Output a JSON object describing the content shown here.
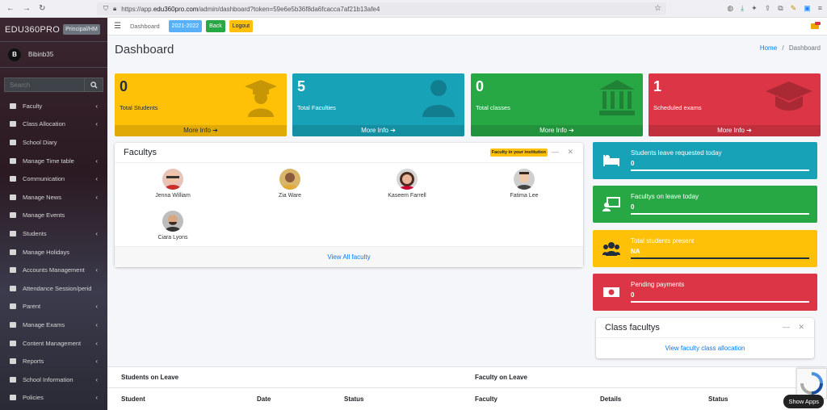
{
  "browser": {
    "url_host": "https://app.",
    "url_domain": "edu360pro.com",
    "url_path": "/admin/dashboard?token=59e6e5b36f8da6fcacca7af21b13afe4"
  },
  "sidebar": {
    "brand": "EDU360PRO",
    "role": "Principal/HM",
    "user_initial": "B",
    "user_name": "Bibinb35",
    "search_placeholder": "Search",
    "items": [
      {
        "label": "Faculty",
        "icon": "faculty-icon",
        "chev": true
      },
      {
        "label": "Class Allocation",
        "icon": "class-allocation-icon",
        "chev": true
      },
      {
        "label": "School Diary",
        "icon": "diary-icon",
        "chev": false
      },
      {
        "label": "Manage Time table",
        "icon": "timetable-icon",
        "chev": true
      },
      {
        "label": "Communication",
        "icon": "communication-icon",
        "chev": true
      },
      {
        "label": "Manage News",
        "icon": "news-icon",
        "chev": true
      },
      {
        "label": "Manage Events",
        "icon": "events-icon",
        "chev": false
      },
      {
        "label": "Students",
        "icon": "students-icon",
        "chev": true
      },
      {
        "label": "Manage Holidays",
        "icon": "holidays-icon",
        "chev": false
      },
      {
        "label": "Accounts Management",
        "icon": "accounts-icon",
        "chev": true
      },
      {
        "label": "Attendance Session/perid",
        "icon": "attendance-icon",
        "chev": false
      },
      {
        "label": "Parent",
        "icon": "parent-icon",
        "chev": true
      },
      {
        "label": "Manage Exams",
        "icon": "exams-icon",
        "chev": true
      },
      {
        "label": "Content Management",
        "icon": "content-icon",
        "chev": true
      },
      {
        "label": "Reports",
        "icon": "reports-icon",
        "chev": true
      },
      {
        "label": "School Information",
        "icon": "info-icon",
        "chev": true
      },
      {
        "label": "Policies",
        "icon": "policies-icon",
        "chev": true
      }
    ]
  },
  "topnav": {
    "dashboard_link": "Dashboard",
    "year": "2021-2022",
    "back": "Back",
    "logout": "Logout"
  },
  "page": {
    "title": "Dashboard",
    "breadcrumb_home": "Home",
    "breadcrumb_sep": "/",
    "breadcrumb_current": "Dashboard"
  },
  "stats": [
    {
      "value": "0",
      "label": "Total Students",
      "more": "More Info",
      "color": "#ffc107"
    },
    {
      "value": "5",
      "label": "Total Faculties",
      "more": "More Info",
      "color": "#17a2b8"
    },
    {
      "value": "0",
      "label": "Total classes",
      "more": "More Info",
      "color": "#28a745"
    },
    {
      "value": "1",
      "label": "Scheduled exams",
      "more": "More Info",
      "color": "#dc3545"
    }
  ],
  "faculty_card": {
    "title": "Facultys",
    "badge": "Faculty in your institution",
    "members": [
      "Jenna William",
      "Zia Ware",
      "Kaseem Farrell",
      "Fatima Lee",
      "Ciara Lyons"
    ],
    "view_all": "View All faculty"
  },
  "info_boxes": [
    {
      "title": "Students leave requested today",
      "value": "0",
      "icon": "bed-icon",
      "color": "#17a2b8"
    },
    {
      "title": "Facultys on leave today",
      "value": "0",
      "icon": "teacher-icon",
      "color": "#28a745"
    },
    {
      "title": "Total students present",
      "value": "NA",
      "icon": "users-icon",
      "color": "#ffc107"
    },
    {
      "title": "Pending payments",
      "value": "0",
      "icon": "money-icon",
      "color": "#dc3545"
    }
  ],
  "class_card": {
    "title": "Class facultys",
    "link": "View faculty class allocation"
  },
  "students_leave": {
    "title": "Students on Leave",
    "headers": [
      "Student",
      "Date",
      "Status"
    ]
  },
  "faculty_leave": {
    "title": "Faculty on Leave",
    "headers": [
      "Faculty",
      "Details",
      "Status"
    ]
  },
  "show_apps": "Show Apps"
}
